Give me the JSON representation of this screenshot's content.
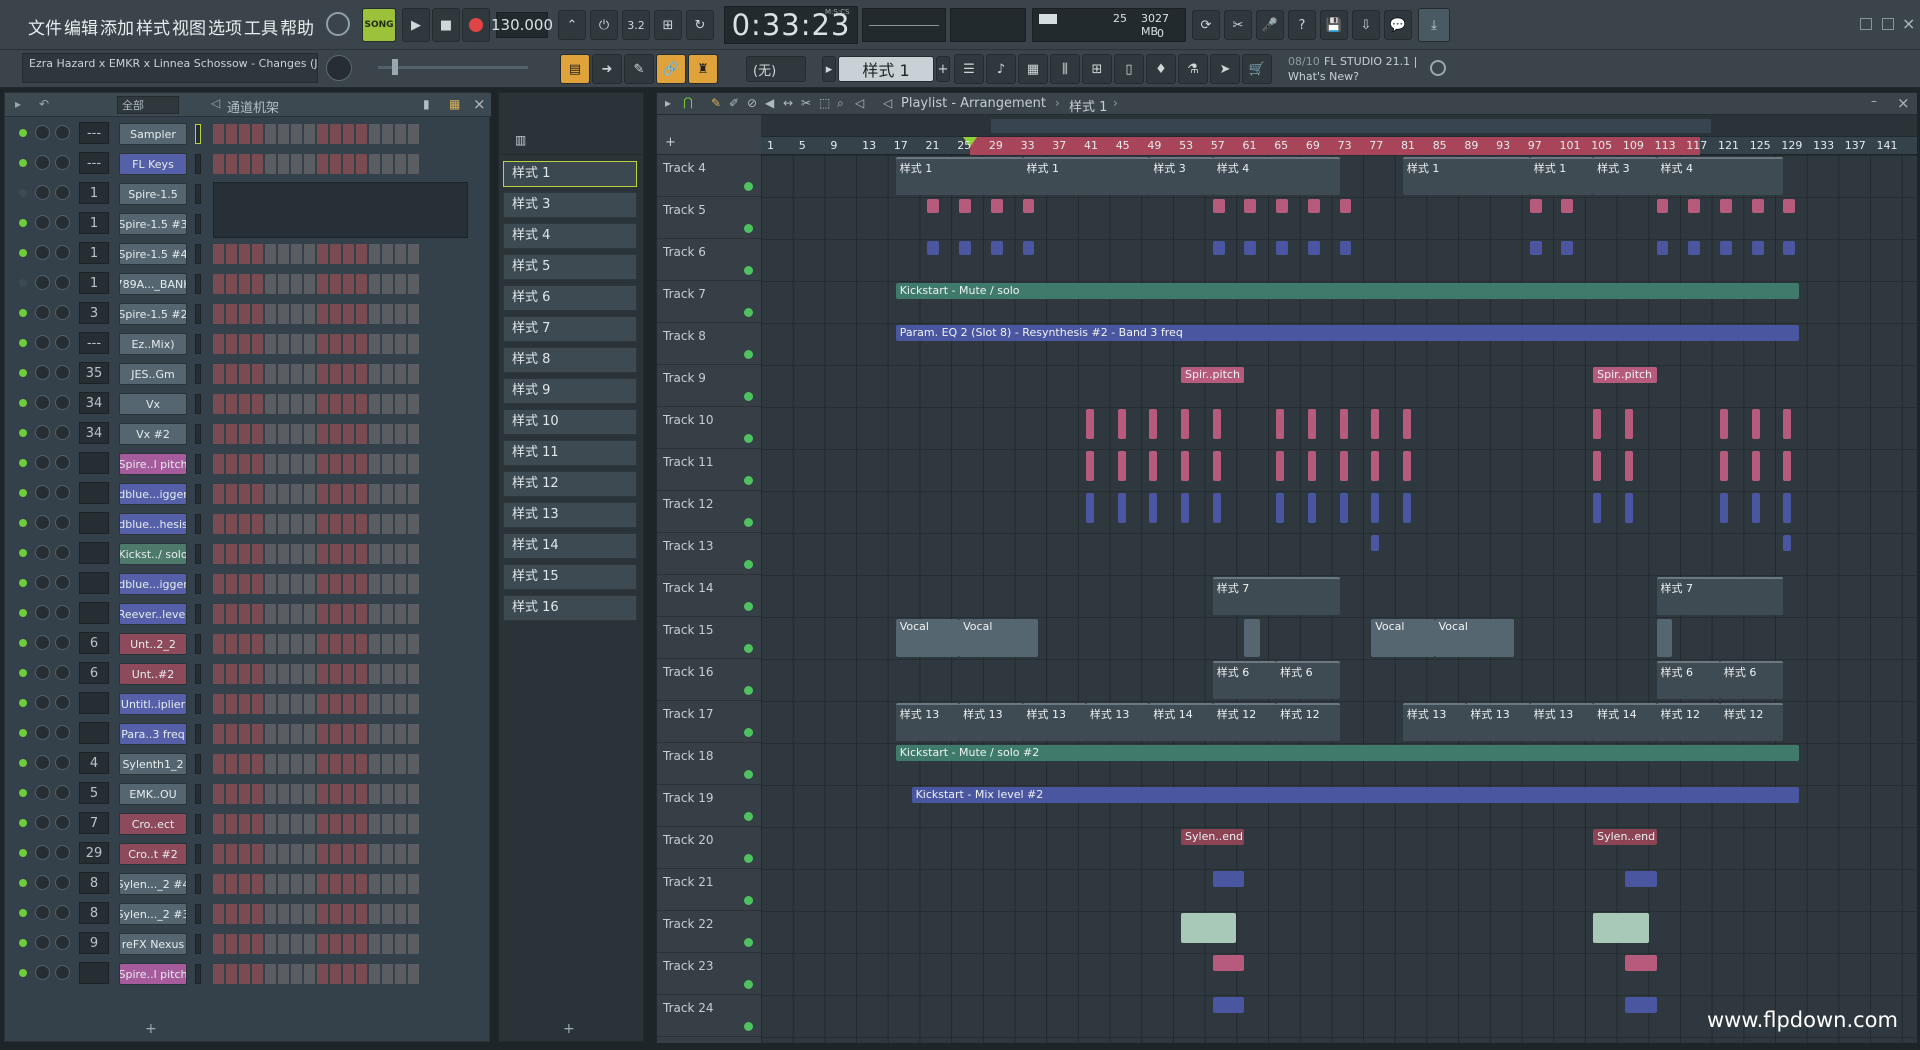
{
  "app": {
    "name": "FL Studio"
  },
  "menu": [
    "文件",
    "编辑",
    "添加",
    "样式",
    "视图",
    "选项",
    "工具",
    "帮助"
  ],
  "transport": {
    "song_label": "SONG",
    "tempo": "130.000",
    "time": "0:33:23",
    "time_unit": "M:S:CS",
    "cpu": "25",
    "memory": "3027 MB",
    "voices": "0"
  },
  "hint_bar": {
    "text": "Ezra Hazard x EMKR x Linnea Schossow - Changes (J"
  },
  "pattern_selector": {
    "value": "(无)",
    "current": "样式 1"
  },
  "news": {
    "date": "08/10",
    "title": "FL STUDIO 21.1 |",
    "link": "What's New?"
  },
  "channel_rack": {
    "title": "通道机架",
    "filter": "全部",
    "channels": [
      {
        "num": "---",
        "name": "Sampler",
        "color": "grey"
      },
      {
        "num": "---",
        "name": "FL Keys",
        "color": "blue"
      },
      {
        "num": "1",
        "name": "Spire-1.5",
        "color": "grey"
      },
      {
        "num": "1",
        "name": "Spire-1.5 #3",
        "color": "grey"
      },
      {
        "num": "1",
        "name": "Spire-1.5 #4",
        "color": "grey"
      },
      {
        "num": "1",
        "name": "789A..._BANK",
        "color": "grey"
      },
      {
        "num": "3",
        "name": "Spire-1.5 #2",
        "color": "grey"
      },
      {
        "num": "---",
        "name": "Ez..Mix)",
        "color": "grey"
      },
      {
        "num": "35",
        "name": "JES..Gm",
        "color": "grey"
      },
      {
        "num": "34",
        "name": "Vx",
        "color": "grey"
      },
      {
        "num": "34",
        "name": "Vx #2",
        "color": "grey"
      },
      {
        "num": "",
        "name": "Spire..l pitch",
        "color": "pink"
      },
      {
        "num": "",
        "name": "dblue...igger",
        "color": "blue"
      },
      {
        "num": "",
        "name": "dblue...hesis",
        "color": "blue"
      },
      {
        "num": "",
        "name": "Kickst../ solo",
        "color": "green"
      },
      {
        "num": "",
        "name": "dblue...igger",
        "color": "blue"
      },
      {
        "num": "",
        "name": "Reever..level",
        "color": "blue"
      },
      {
        "num": "6",
        "name": "Unt..2_2",
        "color": "red"
      },
      {
        "num": "6",
        "name": "Unt..#2",
        "color": "red"
      },
      {
        "num": "",
        "name": "Untitl..iplier",
        "color": "blue"
      },
      {
        "num": "",
        "name": "Para..3 freq",
        "color": "blue"
      },
      {
        "num": "4",
        "name": "Sylenth1_2",
        "color": "grey"
      },
      {
        "num": "5",
        "name": "EMK..OU",
        "color": "grey"
      },
      {
        "num": "7",
        "name": "Cro..ect",
        "color": "red"
      },
      {
        "num": "29",
        "name": "Cro..t #2",
        "color": "red"
      },
      {
        "num": "8",
        "name": "Sylen..._2 #4",
        "color": "grey"
      },
      {
        "num": "8",
        "name": "Sylen..._2 #3",
        "color": "grey"
      },
      {
        "num": "9",
        "name": "reFX Nexus",
        "color": "grey"
      },
      {
        "num": "",
        "name": "Spire..l pitch",
        "color": "pink"
      }
    ]
  },
  "patterns": [
    "样式 1",
    "样式 3",
    "样式 4",
    "样式 5",
    "样式 6",
    "样式 7",
    "样式 8",
    "样式 9",
    "样式 10",
    "样式 11",
    "样式 12",
    "样式 13",
    "样式 14",
    "样式 15",
    "样式 16"
  ],
  "playlist": {
    "breadcrumb": "Playlist - Arrangement",
    "pattern": "样式 1",
    "ruler": [
      "1",
      "5",
      "9",
      "13",
      "17",
      "21",
      "25",
      "29",
      "33",
      "37",
      "41",
      "45",
      "49",
      "53",
      "57",
      "61",
      "65",
      "69",
      "73",
      "77",
      "81",
      "85",
      "89",
      "93",
      "97",
      "101",
      "105",
      "109",
      "113",
      "117",
      "121",
      "125",
      "129",
      "133",
      "137",
      "141"
    ],
    "tracks": [
      "Track 4",
      "Track 5",
      "Track 6",
      "Track 7",
      "Track 8",
      "Track 9",
      "Track 10",
      "Track 11",
      "Track 12",
      "Track 13",
      "Track 14",
      "Track 15",
      "Track 16",
      "Track 17",
      "Track 18",
      "Track 19",
      "Track 20",
      "Track 21",
      "Track 22",
      "Track 23",
      "Track 24"
    ],
    "clip_labels": {
      "p1": "样式 1",
      "p3": "样式 3",
      "p4": "样式 4",
      "p6": "样式 6",
      "p7": "样式 7",
      "p12": "样式 12",
      "p13": "样式 13",
      "p14": "样式 14",
      "kick1": "Kickstart - Mute / solo",
      "eq": "Param. EQ 2 (Slot 8) - Resynthesis #2 - Band 3 freq",
      "spir": "Spir..pitch",
      "vocal": "Vocal",
      "kick2": "Kickstart - Mute / solo #2",
      "kick3": "Kickstart - Mix level #2",
      "sylen": "Sylen..end"
    }
  },
  "watermark": "www.flpdown.com"
}
